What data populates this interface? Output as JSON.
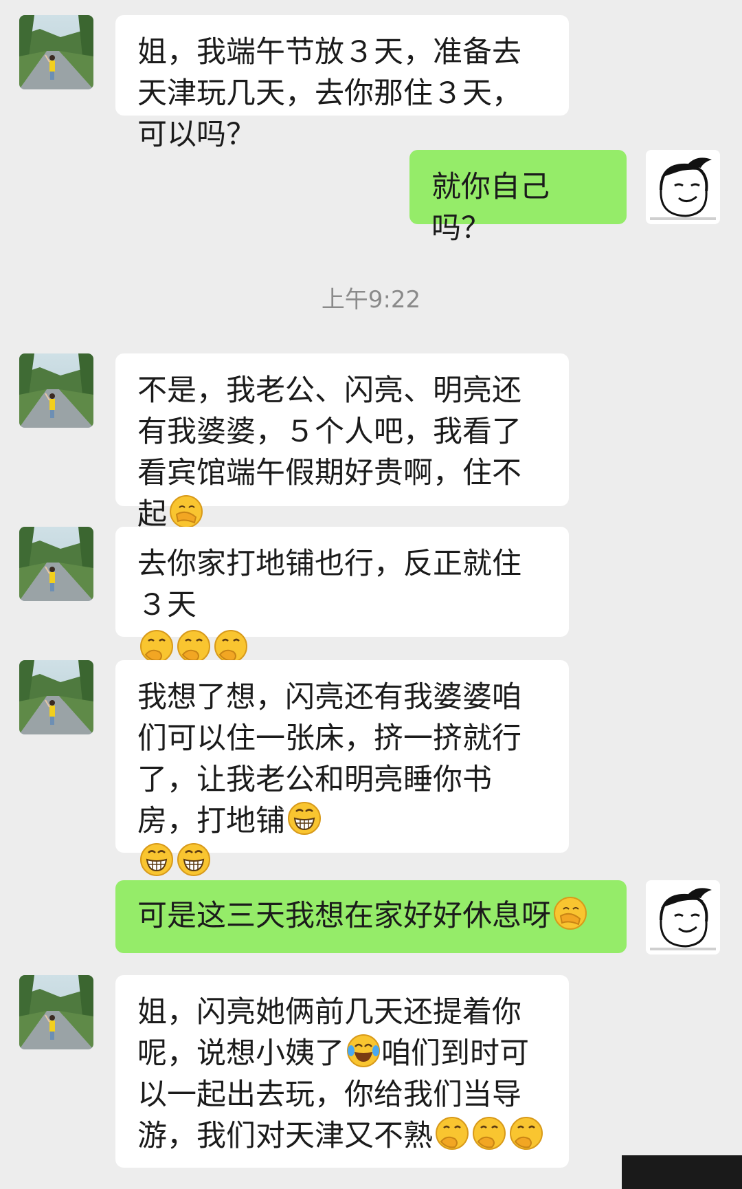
{
  "timestamp": "上午9:22",
  "messages": [
    {
      "side": "in",
      "text": "姐，我端午节放３天，准备去天津玩几天，去你那住３天，可以吗？",
      "emojis": []
    },
    {
      "side": "out",
      "text": "就你自己吗？",
      "emojis": []
    },
    {
      "side": "in",
      "text": "不是，我老公、闪亮、明亮还有我婆婆，５个人吧，我看了看宾馆端午假期好贵啊，住不起",
      "emojis": [
        "facepalm-emoji"
      ]
    },
    {
      "side": "in",
      "text": "去你家打地铺也行，反正就住３天",
      "emojis": [
        "smirk-emoji",
        "smirk-emoji",
        "smirk-emoji"
      ]
    },
    {
      "side": "in",
      "text": "我想了想，闪亮还有我婆婆咱们可以住一张床，挤一挤就行了，让我老公和明亮睡你书房，打地铺",
      "emojis": [
        "grin-emoji",
        "grin-emoji",
        "grin-emoji"
      ]
    },
    {
      "side": "out",
      "text": "可是这三天我想在家好好休息呀",
      "emojis": [
        "facepalm-emoji"
      ]
    },
    {
      "side": "in",
      "text": "姐，闪亮她俩前几天还提着你呢，说想小姨了",
      "text2": "咱们到时可以一起出去玩，你给我们当导游，我们对天津又不熟",
      "emojis": [
        "tears-of-joy-emoji"
      ],
      "emojis2": [
        "smirk-emoji",
        "smirk-emoji",
        "smirk-emoji"
      ]
    }
  ],
  "colors": {
    "incoming": "#ffffff",
    "outgoing": "#95ec69",
    "background": "#ededed"
  }
}
